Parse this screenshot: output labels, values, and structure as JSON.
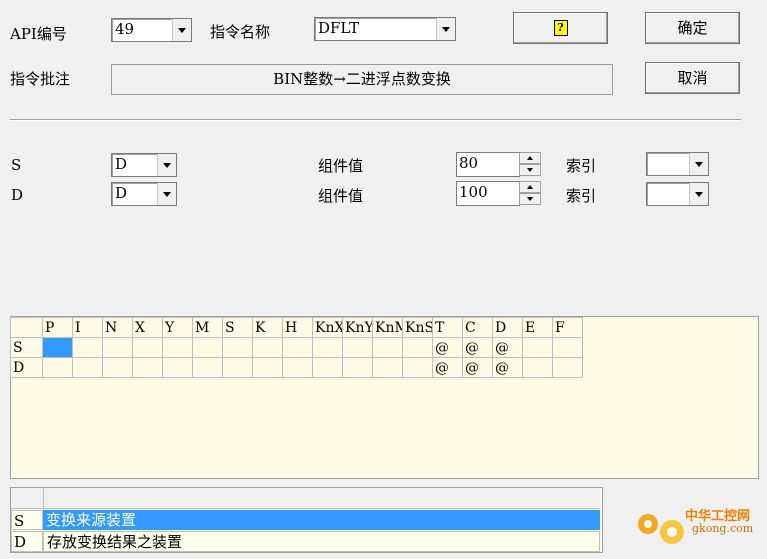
{
  "top": {
    "api_label": "API编号",
    "api_value": "49",
    "cmd_name_label": "指令名称",
    "cmd_name_value": "DFLT",
    "help_button": "?",
    "ok_button": "确定",
    "remark_label": "指令批注",
    "remark_value": "BIN整数→二进浮点数变换",
    "cancel_button": "取消"
  },
  "operands": [
    {
      "name": "S",
      "type": "D",
      "value_label": "组件值",
      "value": "80",
      "index_label": "索引",
      "index_value": ""
    },
    {
      "name": "D",
      "type": "D",
      "value_label": "组件值",
      "value": "100",
      "index_label": "索引",
      "index_value": ""
    }
  ],
  "device_table": {
    "headers": [
      "P",
      "I",
      "N",
      "X",
      "Y",
      "M",
      "S",
      "K",
      "H",
      "KnX",
      "KnY",
      "KnM",
      "KnS",
      "T",
      "C",
      "D",
      "E",
      "F"
    ],
    "rows": [
      {
        "label": "S",
        "cells": [
          "",
          "",
          "",
          "",
          "",
          "",
          "",
          "",
          "",
          "",
          "",
          "",
          "",
          "@",
          "@",
          "@",
          "",
          ""
        ]
      },
      {
        "label": "D",
        "cells": [
          "",
          "",
          "",
          "",
          "",
          "",
          "",
          "",
          "",
          "",
          "",
          "",
          "",
          "@",
          "@",
          "@",
          "",
          ""
        ]
      }
    ]
  },
  "desc_table": {
    "rows": [
      {
        "label": "S",
        "text": "变换来源装置",
        "selected": true
      },
      {
        "label": "D",
        "text": "存放变换结果之装置",
        "selected": false
      }
    ]
  },
  "watermark": {
    "text": "中华工控网",
    "url": "gkong.com"
  },
  "colors": {
    "selection": "#3399ff",
    "grid_bg": "#fffbe6",
    "table_bg": "#ffffee"
  }
}
